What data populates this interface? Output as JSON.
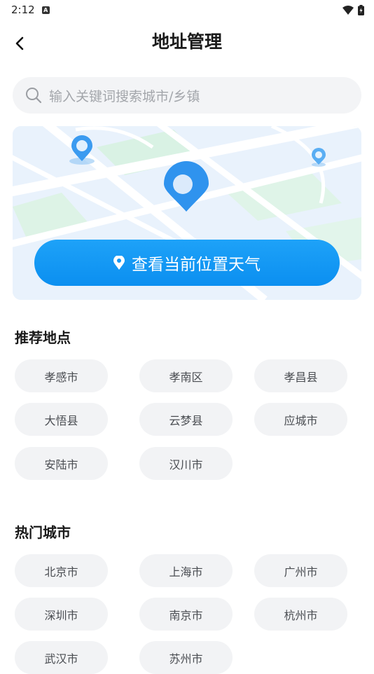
{
  "status_bar": {
    "time": "2:12"
  },
  "header": {
    "title": "地址管理"
  },
  "search": {
    "placeholder": "输入关键词搜索城市/乡镇"
  },
  "locate": {
    "label": "查看当前位置天气"
  },
  "recommended": {
    "title": "推荐地点",
    "items": [
      "孝感市",
      "孝南区",
      "孝昌县",
      "大悟县",
      "云梦县",
      "应城市",
      "安陆市",
      "汉川市"
    ]
  },
  "hot": {
    "title": "热门城市",
    "items": [
      "北京市",
      "上海市",
      "广州市",
      "深圳市",
      "南京市",
      "杭州市",
      "武汉市",
      "苏州市"
    ]
  },
  "colors": {
    "accent": "#0b8ff0",
    "chip_bg": "#f2f3f5",
    "search_bg": "#f3f4f6"
  }
}
